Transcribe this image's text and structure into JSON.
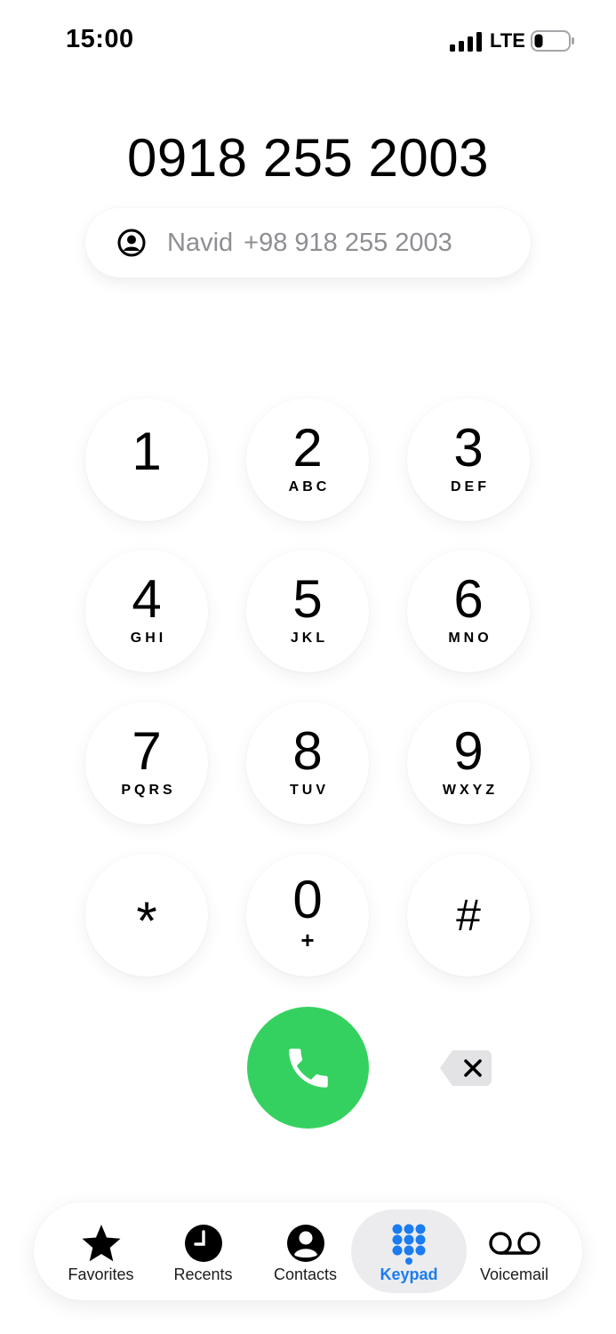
{
  "status_bar": {
    "time": "15:00",
    "network": "LTE",
    "signal_icon": "cellular-signal-icon",
    "battery_icon": "battery-low-icon"
  },
  "dialer": {
    "number": "0918 255 2003",
    "suggestion": {
      "name": "Navid",
      "phone": "+98 918 255 2003",
      "icon": "person-circle-icon"
    }
  },
  "keypad": {
    "keys": [
      {
        "digit": "1",
        "letters": ""
      },
      {
        "digit": "2",
        "letters": "ABC"
      },
      {
        "digit": "3",
        "letters": "DEF"
      },
      {
        "digit": "4",
        "letters": "GHI"
      },
      {
        "digit": "5",
        "letters": "JKL"
      },
      {
        "digit": "6",
        "letters": "MNO"
      },
      {
        "digit": "7",
        "letters": "PQRS"
      },
      {
        "digit": "8",
        "letters": "TUV"
      },
      {
        "digit": "9",
        "letters": "WXYZ"
      },
      {
        "digit": "*",
        "letters": ""
      },
      {
        "digit": "0",
        "letters": "+"
      },
      {
        "digit": "#",
        "letters": ""
      }
    ],
    "call_icon": "phone-icon",
    "delete_icon": "delete-backspace-icon"
  },
  "tab_bar": {
    "tabs": [
      {
        "label": "Favorites",
        "icon": "star-icon",
        "active": false
      },
      {
        "label": "Recents",
        "icon": "clock-icon",
        "active": false
      },
      {
        "label": "Contacts",
        "icon": "person-circle-icon",
        "active": false
      },
      {
        "label": "Keypad",
        "icon": "keypad-grid-icon",
        "active": true
      },
      {
        "label": "Voicemail",
        "icon": "voicemail-icon",
        "active": false
      }
    ]
  },
  "colors": {
    "call_green": "#35d160",
    "active_tab_blue": "#1a7cf0",
    "secondary_text": "#8e8e93"
  }
}
